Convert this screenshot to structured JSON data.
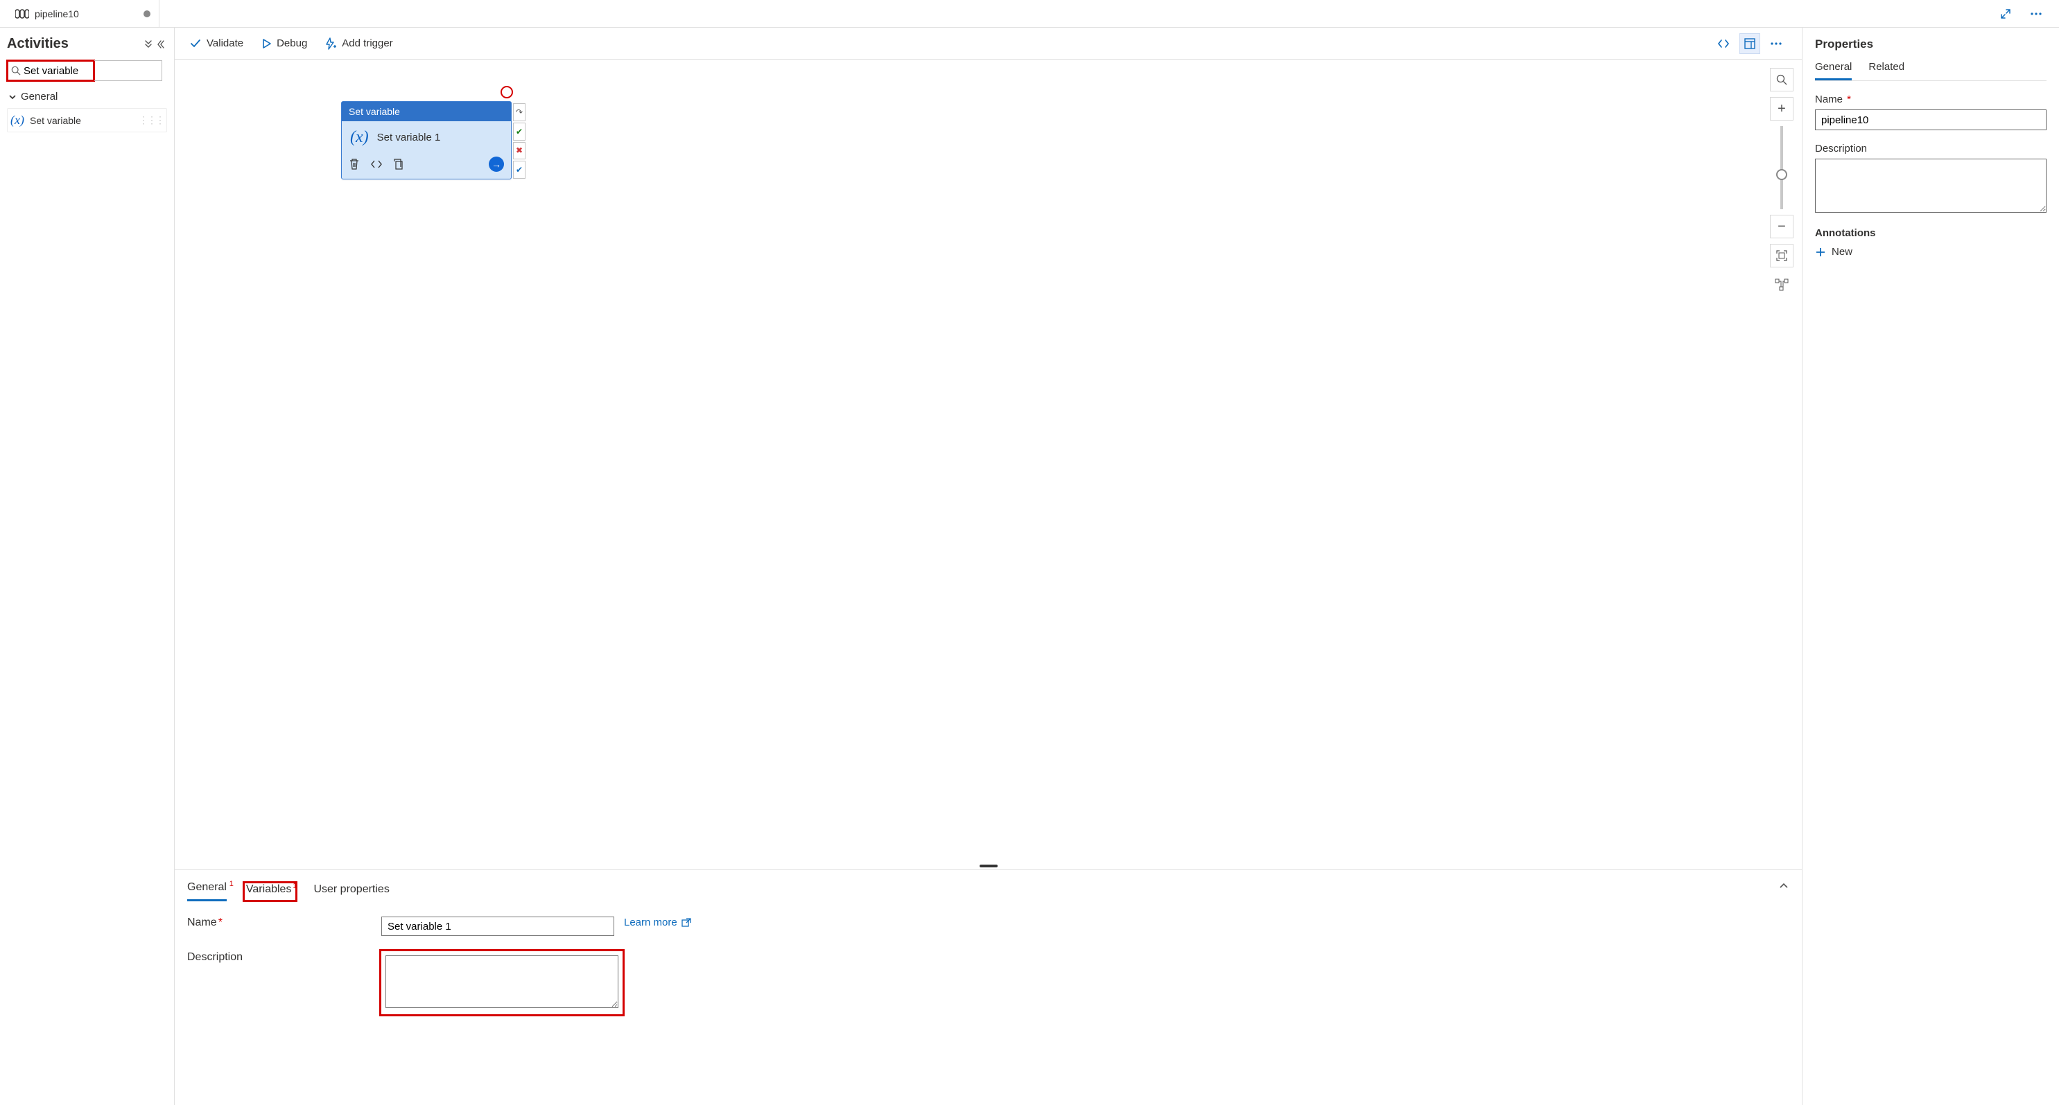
{
  "tab": {
    "title": "pipeline10"
  },
  "sidebar": {
    "title": "Activities",
    "search_value": "Set variable",
    "category_general": "General",
    "items": [
      {
        "label": "Set variable"
      }
    ]
  },
  "toolbar": {
    "validate": "Validate",
    "debug": "Debug",
    "add_trigger": "Add trigger"
  },
  "node": {
    "type_label": "Set variable",
    "name": "Set variable 1"
  },
  "bottom": {
    "tabs": {
      "general": "General",
      "variables": "Variables",
      "user_properties": "User properties"
    },
    "name_label": "Name",
    "name_value": "Set variable 1",
    "description_label": "Description",
    "description_value": "",
    "learn_more": "Learn more"
  },
  "properties": {
    "title": "Properties",
    "tabs": {
      "general": "General",
      "related": "Related"
    },
    "name_label": "Name",
    "name_value": "pipeline10",
    "description_label": "Description",
    "description_value": "",
    "annotations_label": "Annotations",
    "new_label": "New"
  }
}
